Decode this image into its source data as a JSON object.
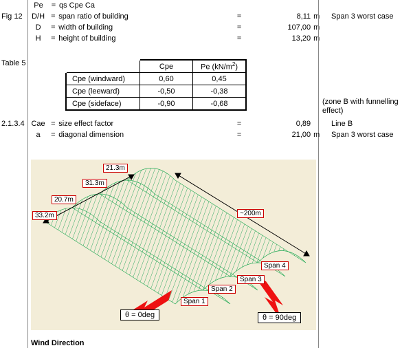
{
  "rows": {
    "pe": {
      "ref": "",
      "sym": "Pe",
      "desc": "qs Cpe Ca"
    },
    "dh": {
      "ref": "Fig 12",
      "sym": "D/H",
      "desc": "span ratio of building",
      "val": "8,11",
      "unit": "m",
      "note": "Span 3 worst case"
    },
    "d": {
      "ref": "",
      "sym": "D",
      "desc": "width of building",
      "val": "107,00",
      "unit": "m",
      "note": ""
    },
    "h": {
      "ref": "",
      "sym": "H",
      "desc": "height of building",
      "val": "13,20",
      "unit": "m",
      "note": ""
    },
    "tbl": {
      "ref": "Table 5"
    },
    "zone": {
      "note": "(zone B with funnelling effect)"
    },
    "cae": {
      "ref": "2.1.3.4",
      "sym": "Cae",
      "desc": "size effect factor",
      "val": "0,89",
      "unit": "",
      "note": "Line B"
    },
    "a": {
      "ref": "",
      "sym": "a",
      "desc": "diagonal dimension",
      "val": "21,00",
      "unit": "m",
      "note": "Span 3 worst case"
    }
  },
  "table": {
    "h1": "Cpe",
    "h2": "Pe (kN/m",
    "r1": {
      "lab": "Cpe (windward)",
      "c": "0,60",
      "p": "0,45"
    },
    "r2": {
      "lab": "Cpe (leeward)",
      "c": "-0,50",
      "p": "-0,38"
    },
    "r3": {
      "lab": "Cpe (sideface)",
      "c": "-0,90",
      "p": "-0,68"
    }
  },
  "diagram": {
    "d1": "21.3m",
    "d2": "31.3m",
    "d3": "20.7m",
    "d4": "33.2m",
    "d5": "~200m",
    "s1": "Span 1",
    "s2": "Span 2",
    "s3": "Span 3",
    "s4": "Span 4",
    "t0": "θ = 0deg",
    "t90": "θ = 90deg",
    "caption": "Wind Direction"
  }
}
